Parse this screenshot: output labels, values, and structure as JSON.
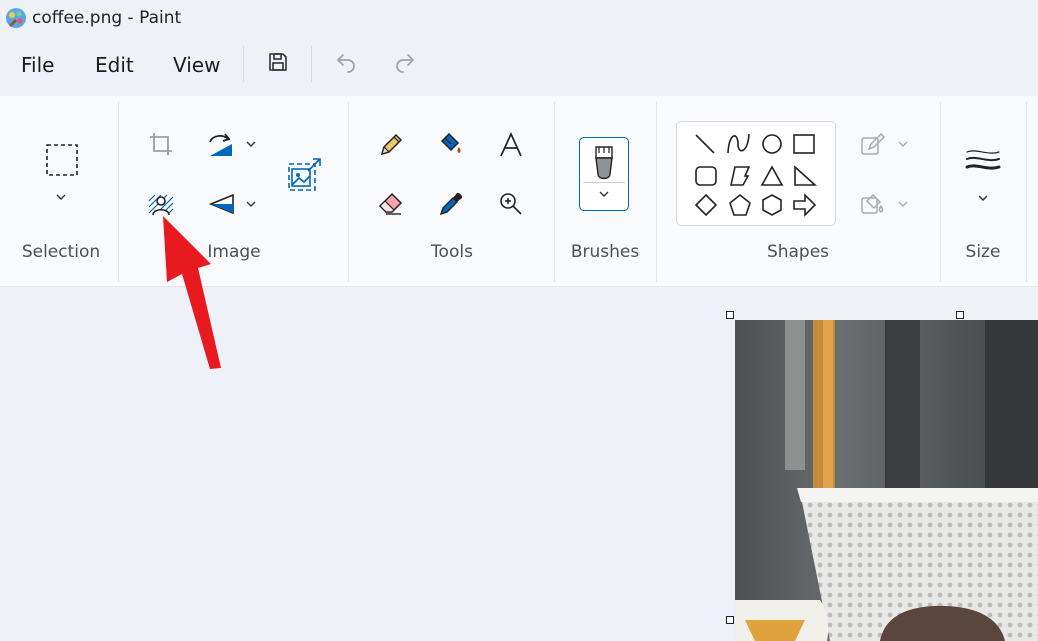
{
  "window": {
    "title": "coffee.png - Paint"
  },
  "menu": {
    "file": "File",
    "edit": "Edit",
    "view": "View"
  },
  "ribbon": {
    "groups": {
      "selection": "Selection",
      "image": "Image",
      "tools": "Tools",
      "brushes": "Brushes",
      "shapes": "Shapes",
      "size": "Size"
    }
  },
  "colors": {
    "accent": "#0067c0",
    "annotation_arrow": "#e8191f",
    "canvas_background": "#eef2f8",
    "ribbon_background": "#f9fafc"
  },
  "icons": [
    "paint-app-icon",
    "save-icon",
    "undo-icon",
    "redo-icon",
    "rectangle-selection-icon",
    "crop-icon",
    "rotate-icon",
    "flip-icon",
    "remove-background-icon",
    "resize-icon",
    "pencil-icon",
    "fill-icon",
    "text-icon",
    "eraser-icon",
    "color-picker-icon",
    "magnifier-icon",
    "brush-icon",
    "outline-icon",
    "shape-fill-icon",
    "stroke-size-icon"
  ]
}
